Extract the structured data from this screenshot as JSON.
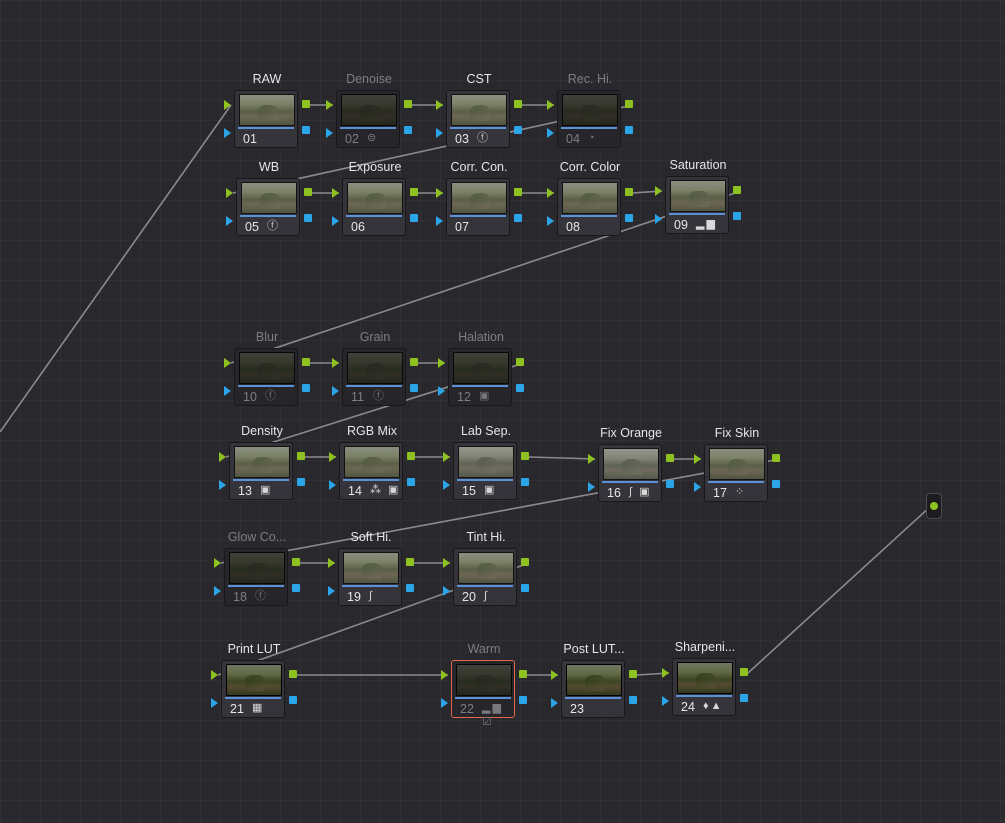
{
  "nodes": [
    {
      "id": "01",
      "label": "RAW",
      "number": "01",
      "icon": "",
      "disabled": false,
      "selected": false,
      "tone": ""
    },
    {
      "id": "02",
      "label": "Denoise",
      "number": "02",
      "icon": "denoise-icon",
      "disabled": true,
      "selected": false,
      "tone": "dark"
    },
    {
      "id": "03",
      "label": "CST",
      "number": "03",
      "icon": "fx-icon",
      "disabled": false,
      "selected": false,
      "tone": ""
    },
    {
      "id": "04",
      "label": "Rec. Hi.",
      "number": "04",
      "icon": "hdr-icon",
      "disabled": true,
      "selected": false,
      "tone": "dark"
    },
    {
      "id": "05",
      "label": "WB",
      "number": "05",
      "icon": "fx-icon",
      "disabled": false,
      "selected": false,
      "tone": ""
    },
    {
      "id": "06",
      "label": "Exposure",
      "number": "06",
      "icon": "",
      "disabled": false,
      "selected": false,
      "tone": ""
    },
    {
      "id": "07",
      "label": "Corr. Con.",
      "number": "07",
      "icon": "",
      "disabled": false,
      "selected": false,
      "tone": ""
    },
    {
      "id": "08",
      "label": "Corr. Color",
      "number": "08",
      "icon": "",
      "disabled": false,
      "selected": false,
      "tone": ""
    },
    {
      "id": "09",
      "label": "Saturation",
      "number": "09",
      "icon": "bars-icon",
      "disabled": false,
      "selected": false,
      "tone": ""
    },
    {
      "id": "10",
      "label": "Blur",
      "number": "10",
      "icon": "fx-icon",
      "disabled": true,
      "selected": false,
      "tone": "dark"
    },
    {
      "id": "11",
      "label": "Grain",
      "number": "11",
      "icon": "fx-icon",
      "disabled": true,
      "selected": false,
      "tone": "dark"
    },
    {
      "id": "12",
      "label": "Halation",
      "number": "12",
      "icon": "compound-icon",
      "disabled": true,
      "selected": false,
      "tone": "dark"
    },
    {
      "id": "13",
      "label": "Density",
      "number": "13",
      "icon": "compound-icon",
      "disabled": false,
      "selected": false,
      "tone": ""
    },
    {
      "id": "14",
      "label": "RGB Mix",
      "number": "14",
      "icon": "rgb-mixer-compound-icon",
      "disabled": false,
      "selected": false,
      "tone": ""
    },
    {
      "id": "15",
      "label": "Lab Sep.",
      "number": "15",
      "icon": "compound-icon",
      "disabled": false,
      "selected": false,
      "tone": "cool"
    },
    {
      "id": "16",
      "label": "Fix Orange",
      "number": "16",
      "icon": "curve-compound-icon",
      "disabled": false,
      "selected": false,
      "tone": "cool"
    },
    {
      "id": "17",
      "label": "Fix Skin",
      "number": "17",
      "icon": "sparkle-icon",
      "disabled": false,
      "selected": false,
      "tone": ""
    },
    {
      "id": "18",
      "label": "Glow Co...",
      "number": "18",
      "icon": "fx-icon",
      "disabled": true,
      "selected": false,
      "tone": "dark"
    },
    {
      "id": "19",
      "label": "Soft Hi.",
      "number": "19",
      "icon": "curve-icon",
      "disabled": false,
      "selected": false,
      "tone": ""
    },
    {
      "id": "20",
      "label": "Tint Hi.",
      "number": "20",
      "icon": "curve-icon",
      "disabled": false,
      "selected": false,
      "tone": ""
    },
    {
      "id": "21",
      "label": "Print LUT",
      "number": "21",
      "icon": "lut-icon",
      "disabled": false,
      "selected": false,
      "tone": "deep"
    },
    {
      "id": "22",
      "label": "Warm",
      "number": "22",
      "icon": "bars-check-icon",
      "disabled": true,
      "selected": true,
      "tone": "dark"
    },
    {
      "id": "23",
      "label": "Post LUT...",
      "number": "23",
      "icon": "",
      "disabled": false,
      "selected": false,
      "tone": "deep"
    },
    {
      "id": "24",
      "label": "Sharpeni...",
      "number": "24",
      "icon": "sharpen-icon",
      "disabled": false,
      "selected": false,
      "tone": "deep"
    }
  ],
  "icons": {
    "fx-icon": "ⓕ",
    "denoise-icon": "⊜",
    "hdr-icon": "◔",
    "bars-icon": "▂▆",
    "compound-icon": "▣",
    "rgb-mixer-compound-icon": "⁂ ▣",
    "curve-compound-icon": "∫ ▣",
    "sparkle-icon": "⁘",
    "curve-icon": "∫",
    "lut-icon": "▦",
    "bars-check-icon": "▂▆ ☑",
    "sharpen-icon": "♦▲"
  },
  "colors": {
    "rgb_port": "#8dc21f",
    "key_port": "#2ba4e8",
    "wire": "#8a8a90",
    "selected_outline": "#e3664a",
    "output_dot": "#8dc21f"
  }
}
